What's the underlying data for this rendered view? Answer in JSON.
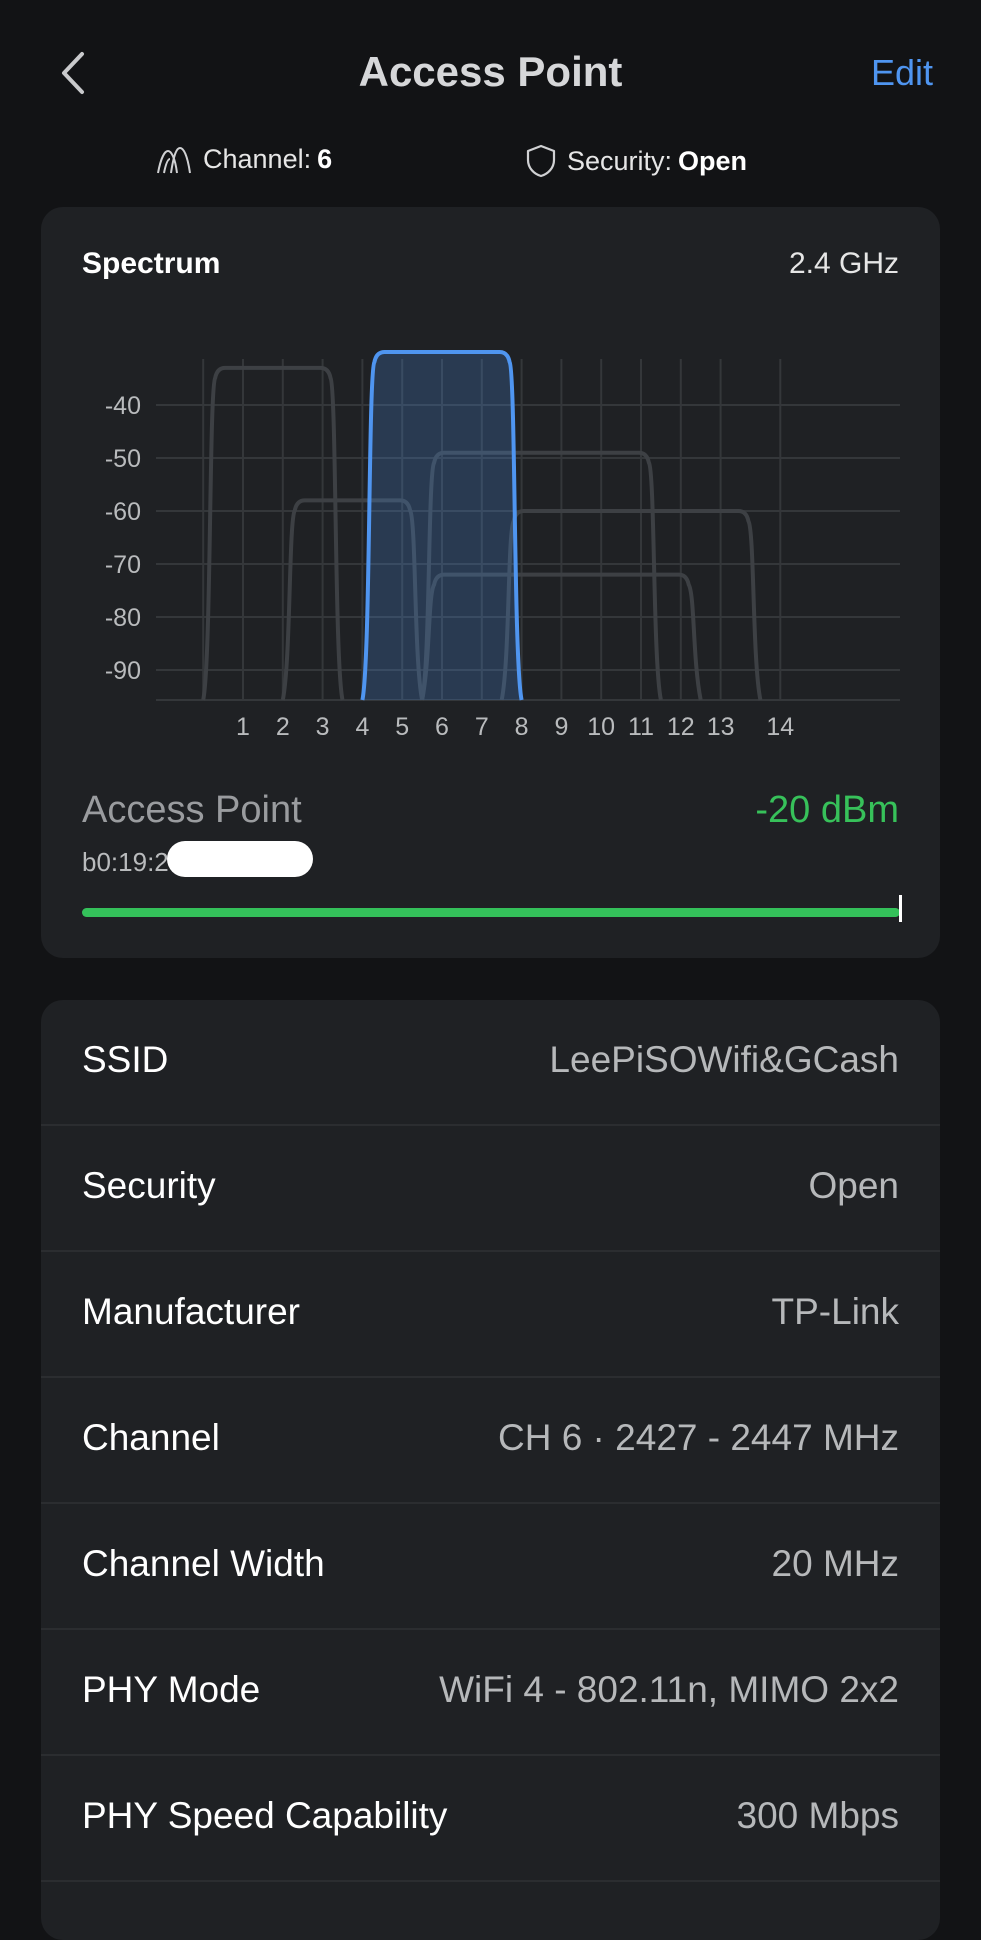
{
  "header": {
    "title": "Access Point",
    "edit_label": "Edit"
  },
  "subinfo": {
    "channel_label": "Channel:",
    "channel_value": "6",
    "security_label": "Security:",
    "security_value": "Open"
  },
  "spectrum": {
    "title": "Spectrum",
    "band": "2.4 GHz",
    "y_ticks": [
      "-40",
      "-50",
      "-60",
      "-70",
      "-80",
      "-90"
    ],
    "x_ticks": [
      "1",
      "2",
      "3",
      "4",
      "5",
      "6",
      "7",
      "8",
      "9",
      "10",
      "11",
      "12",
      "13",
      "14"
    ],
    "selected_color": "#4f95f0",
    "other_color": "#3d4044",
    "networks": [
      {
        "from": 0,
        "to": 3.5,
        "level": -33,
        "selected": false
      },
      {
        "from": 2,
        "to": 5.5,
        "level": -58,
        "selected": false
      },
      {
        "from": 4,
        "to": 8,
        "level": -30,
        "selected": true
      },
      {
        "from": 5.5,
        "to": 11.5,
        "level": -49,
        "selected": false
      },
      {
        "from": 5.5,
        "to": 12.5,
        "level": -72,
        "selected": false
      },
      {
        "from": 7.5,
        "to": 14,
        "level": -60,
        "selected": false
      }
    ]
  },
  "access_point": {
    "name": "Access Point",
    "signal": "-20 dBm",
    "mac_partial": "b0:19:2",
    "signal_fraction": 1.0,
    "signal_color": "#34c15a"
  },
  "details": [
    {
      "key": "SSID",
      "value": "LeePiSOWifi&GCash"
    },
    {
      "key": "Security",
      "value": "Open"
    },
    {
      "key": "Manufacturer",
      "value": "TP-Link"
    },
    {
      "key": "Channel",
      "value": "CH 6 · 2427 - 2447 MHz"
    },
    {
      "key": "Channel Width",
      "value": "20 MHz"
    },
    {
      "key": "PHY Mode",
      "value": "WiFi 4 - 802.11n, MIMO 2x2"
    },
    {
      "key": "PHY Speed Capability",
      "value": "300 Mbps"
    }
  ]
}
